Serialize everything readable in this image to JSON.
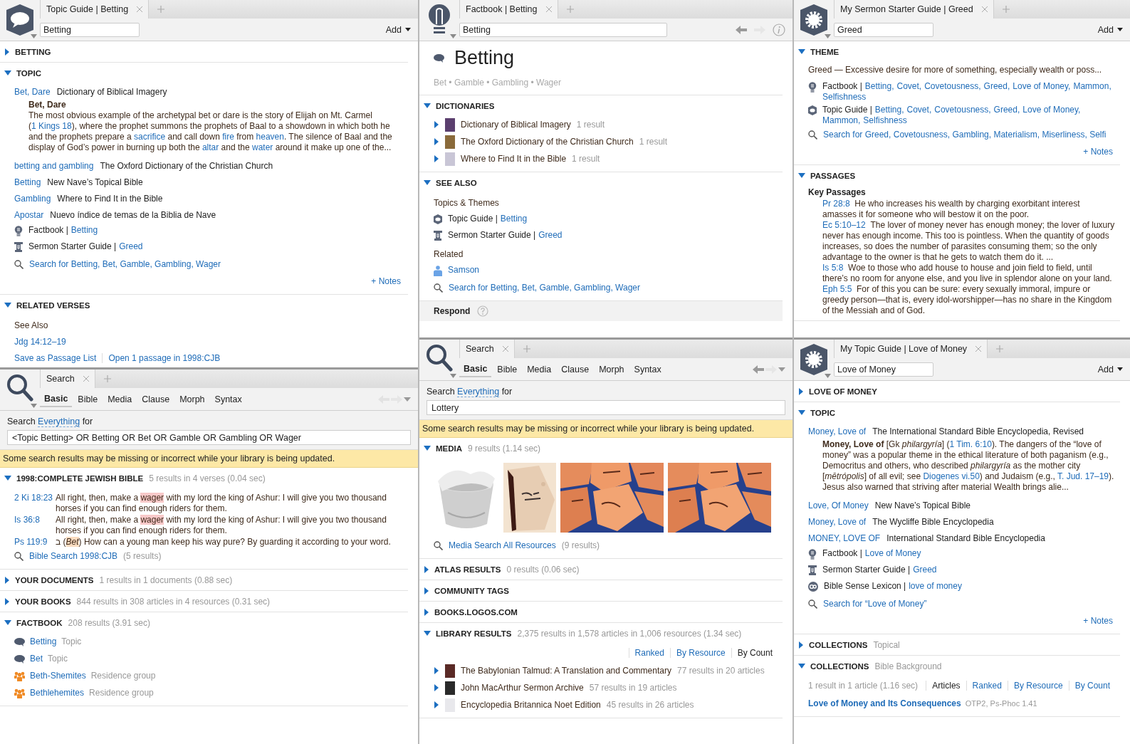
{
  "columns": [
    {
      "panels": [
        {
          "kind": "topic-guide",
          "tab": "Topic Guide | Betting",
          "field": "Betting",
          "add": "Add",
          "sections": [
            {
              "heading": "BETTING",
              "expanded": false
            },
            {
              "heading": "TOPIC",
              "expanded": true,
              "blocks": [
                {
                  "kind": "entry",
                  "link": "Bet, Dare",
                  "source": "Dictionary of Biblical Imagery"
                },
                {
                  "kind": "excerpt",
                  "parts": [
                    {
                      "kind": "title",
                      "text": "Bet, Dare"
                    },
                    {
                      "kind": "text",
                      "text": "The most obvious example of the archetypal bet or dare is the story of Elijah on Mt. Carmel ("
                    },
                    {
                      "kind": "link",
                      "text": "1 Kings 18"
                    },
                    {
                      "kind": "text",
                      "text": "), where the prophet summons the prophets of Baal to a showdown in which both he and the prophets prepare a "
                    },
                    {
                      "kind": "link",
                      "text": "sacrifice"
                    },
                    {
                      "kind": "text",
                      "text": " and call down "
                    },
                    {
                      "kind": "link",
                      "text": "fire"
                    },
                    {
                      "kind": "text",
                      "text": " from "
                    },
                    {
                      "kind": "link",
                      "text": "heaven"
                    },
                    {
                      "kind": "text",
                      "text": ". The silence of Baal and the display of God’s power in burning up both the "
                    },
                    {
                      "kind": "link",
                      "text": "altar"
                    },
                    {
                      "kind": "text",
                      "text": " and the "
                    },
                    {
                      "kind": "link",
                      "text": "water"
                    },
                    {
                      "kind": "text",
                      "text": " around it make up one of the..."
                    }
                  ]
                },
                {
                  "kind": "entry",
                  "link": "betting and gambling",
                  "source": "The Oxford Dictionary of the Christian Church"
                },
                {
                  "kind": "entry",
                  "link": "Betting",
                  "source": "New Nave’s Topical Bible"
                },
                {
                  "kind": "entry",
                  "link": "Gambling",
                  "source": "Where to Find It in the Bible"
                },
                {
                  "kind": "entry",
                  "link": "Apostar",
                  "source": "Nuevo índice de temas de la Biblia de Nave"
                },
                {
                  "kind": "factbook-ref",
                  "name": "Factbook",
                  "sep": "|",
                  "links": [
                    "Betting"
                  ]
                },
                {
                  "kind": "sermon-ref",
                  "name": "Sermon Starter Guide",
                  "sep": "|",
                  "links": [
                    "Greed"
                  ]
                },
                {
                  "kind": "search",
                  "text": "Search for Betting, Bet, Gamble, Gambling, Wager"
                },
                {
                  "kind": "notes",
                  "text": "+ Notes"
                }
              ]
            },
            {
              "heading": "RELATED VERSES",
              "expanded": true,
              "blocks": [
                {
                  "kind": "label",
                  "text": "See Also"
                },
                {
                  "kind": "link",
                  "text": "Jdg 14:12–19"
                },
                {
                  "kind": "actions",
                  "links": [
                    "Save as Passage List",
                    "Open 1 passage in 1998:CJB"
                  ]
                }
              ]
            }
          ]
        },
        {
          "kind": "search",
          "tab": "Search",
          "can_go_back": false,
          "modes": [
            {
              "label": "Basic",
              "selected": true
            },
            {
              "label": "Bible",
              "selected": false
            },
            {
              "label": "Media",
              "selected": false
            },
            {
              "label": "Clause",
              "selected": false
            },
            {
              "label": "Morph",
              "selected": false
            },
            {
              "label": "Syntax",
              "selected": false
            }
          ],
          "prompt": {
            "before": "Search",
            "scope": "Everything",
            "after": "for"
          },
          "query": "<Topic Betting> OR Betting OR Bet OR Gamble OR Gambling OR Wager",
          "banner": "Some search results may be missing or incorrect while your library is being updated.",
          "sections": [
            {
              "heading": "1998:COMPLETE JEWISH BIBLE",
              "expanded": true,
              "meta": "5 results in 4 verses (0.04 sec)",
              "blocks": [
                {
                  "kind": "hit",
                  "ref": "2 Ki 18:23",
                  "parts": [
                    {
                      "kind": "text",
                      "text": "All right, then, make a "
                    },
                    {
                      "kind": "hit",
                      "text": "wager"
                    },
                    {
                      "kind": "text",
                      "text": " with my lord the king of Ashur: I will give you two thousand horses if you can find enough riders for them."
                    }
                  ]
                },
                {
                  "kind": "hit",
                  "ref": "Is 36:8",
                  "parts": [
                    {
                      "kind": "text",
                      "text": "All right, then, make a "
                    },
                    {
                      "kind": "hit",
                      "text": "wager"
                    },
                    {
                      "kind": "text",
                      "text": " with my lord the king of Ashur: I will give you two thousand horses if you can find enough riders for them."
                    }
                  ]
                },
                {
                  "kind": "hit",
                  "ref": "Ps 119:9",
                  "parts": [
                    {
                      "kind": "text",
                      "text": "ב ("
                    },
                    {
                      "kind": "hit-italic",
                      "text": "Bet"
                    },
                    {
                      "kind": "text",
                      "text": ") How can a young man keep his way pure? By guarding it according to your word."
                    }
                  ]
                },
                {
                  "kind": "search",
                  "text": "Bible Search 1998:CJB",
                  "count": "(5 results)"
                }
              ]
            },
            {
              "heading": "YOUR DOCUMENTS",
              "expanded": false,
              "meta": "1 results in 1 documents (0.88 sec)"
            },
            {
              "heading": "YOUR BOOKS",
              "expanded": false,
              "meta": "844 results in 308 articles in 4 resources (0.31 sec)"
            },
            {
              "heading": "FACTBOOK",
              "expanded": true,
              "meta": "208 results (3.91 sec)",
              "blocks": [
                {
                  "kind": "topic-fact",
                  "name": "Betting",
                  "type": "Topic"
                },
                {
                  "kind": "topic-fact",
                  "name": "Bet",
                  "type": "Topic"
                },
                {
                  "kind": "group-fact",
                  "name": "Beth-Shemites",
                  "type": "Residence group"
                },
                {
                  "kind": "group-fact",
                  "name": "Bethlehemites",
                  "type": "Residence group"
                }
              ]
            }
          ]
        }
      ]
    },
    {
      "panels": [
        {
          "kind": "factbook",
          "tab": "Factbook | Betting",
          "field": "Betting",
          "can_go_back": true,
          "footer": "Respond",
          "sections": [
            {
              "blocks": [
                {
                  "kind": "title",
                  "text": "Betting",
                  "aliases": "Bet • Gamble • Gambling • Wager"
                }
              ]
            },
            {
              "heading": "DICTIONARIES",
              "expanded": true,
              "blocks": [
                {
                  "kind": "book",
                  "expanded": false,
                  "color": "#5b3f6e",
                  "title": "Dictionary of Biblical Imagery",
                  "meta": "1 result"
                },
                {
                  "kind": "book",
                  "expanded": false,
                  "color": "#8a6a3a",
                  "title": "The Oxford Dictionary of the Christian Church",
                  "meta": "1 result"
                },
                {
                  "kind": "book",
                  "expanded": false,
                  "color": "#c9c6d6",
                  "title": "Where to Find It in the Bible",
                  "meta": "1 result"
                }
              ]
            },
            {
              "heading": "SEE ALSO",
              "expanded": true,
              "blocks": [
                {
                  "kind": "label",
                  "text": "Topics & Themes"
                },
                {
                  "kind": "topic-ref",
                  "name": "Topic Guide",
                  "sep": "|",
                  "links": [
                    "Betting"
                  ]
                },
                {
                  "kind": "sermon-ref",
                  "name": "Sermon Starter Guide",
                  "sep": "|",
                  "links": [
                    "Greed"
                  ]
                },
                {
                  "kind": "label",
                  "text": "Related"
                },
                {
                  "kind": "person-ref",
                  "links": [
                    "Samson"
                  ]
                },
                {
                  "kind": "search",
                  "text": "Search for Betting, Bet, Gamble, Gambling, Wager"
                }
              ]
            }
          ]
        },
        {
          "kind": "search",
          "tab": "Search",
          "can_go_back": true,
          "modes": [
            {
              "label": "Basic",
              "selected": true
            },
            {
              "label": "Bible",
              "selected": false
            },
            {
              "label": "Media",
              "selected": false
            },
            {
              "label": "Clause",
              "selected": false
            },
            {
              "label": "Morph",
              "selected": false
            },
            {
              "label": "Syntax",
              "selected": false
            }
          ],
          "prompt": {
            "before": "Search",
            "scope": "Everything",
            "after": "for"
          },
          "query": "Lottery",
          "banner": "Some search results may be missing or incorrect while your library is being updated.",
          "sections": [
            {
              "heading": "MEDIA",
              "expanded": true,
              "meta": "9 results (1.14 sec)",
              "blocks": [
                {
                  "kind": "media"
                },
                {
                  "kind": "search",
                  "text": "Media Search All Resources",
                  "count": "(9 results)"
                }
              ]
            },
            {
              "heading": "ATLAS RESULTS",
              "expanded": false,
              "meta": "0 results (0.06 sec)"
            },
            {
              "heading": "COMMUNITY TAGS",
              "expanded": false
            },
            {
              "heading": "BOOKS.LOGOS.COM",
              "expanded": false
            },
            {
              "heading": "LIBRARY RESULTS",
              "expanded": true,
              "meta": "2,375 results in 1,578 articles in 1,006 resources (1.34 sec)",
              "blocks": [
                {
                  "kind": "sort",
                  "options": [
                    {
                      "label": "Ranked",
                      "selected": false
                    },
                    {
                      "label": "By Resource",
                      "selected": false
                    },
                    {
                      "label": "By Count",
                      "selected": true
                    }
                  ]
                },
                {
                  "kind": "book",
                  "expanded": false,
                  "color": "#5a2a26",
                  "title": "The Babylonian Talmud: A Translation and Commentary",
                  "meta": "77 results in 20 articles"
                },
                {
                  "kind": "book",
                  "expanded": false,
                  "color": "#2a2a2a",
                  "title": "John MacArthur Sermon Archive",
                  "meta": "57 results in 19 articles"
                },
                {
                  "kind": "book",
                  "expanded": false,
                  "color": "#e8e8ec",
                  "title": "Encyclopedia Britannica Noet Edition",
                  "meta": "45 results in 26 articles"
                }
              ]
            }
          ]
        }
      ]
    },
    {
      "panels": [
        {
          "kind": "custom-guide",
          "tab": "My Sermon Starter Guide | Greed",
          "field": "Greed",
          "add": "Add",
          "sections": [
            {
              "heading": "THEME",
              "expanded": true,
              "blocks": [
                {
                  "kind": "text",
                  "text": "Greed — Excessive desire for more of something, especially wealth or poss..."
                },
                {
                  "kind": "factbook-ref",
                  "name": "Factbook",
                  "sep": "|",
                  "links": [
                    "Betting,",
                    "Covet,",
                    "Covetousness,",
                    "Greed,",
                    "Love of Money,",
                    "Mammon,",
                    "Selfishness"
                  ]
                },
                {
                  "kind": "topic-ref",
                  "name": "Topic Guide",
                  "sep": "|",
                  "links": [
                    "Betting,",
                    "Covet,",
                    "Covetousness,",
                    "Greed,",
                    "Love of Money,",
                    "Mammon,",
                    "Selfishness"
                  ]
                },
                {
                  "kind": "search",
                  "text": "Search for Greed, Covetousness, Gambling, Materialism, Miserliness, Selfi"
                },
                {
                  "kind": "notes",
                  "text": "+ Notes"
                }
              ]
            },
            {
              "heading": "PASSAGES",
              "expanded": true,
              "blocks": [
                {
                  "kind": "subheading",
                  "text": "Key Passages"
                },
                {
                  "kind": "passage",
                  "ref": "Pr 28:8",
                  "text": "He who increases his wealth by charging exorbitant interest amasses it for someone who will bestow it on the poor."
                },
                {
                  "kind": "passage",
                  "ref": "Ec 5:10–12",
                  "text": "The lover of money never has enough money; the lover of luxury never has enough income. This too is pointless. When the quantity of goods increases, so does the number of parasites consuming them; so the only advantage to the owner is that he gets to watch them do it. ..."
                },
                {
                  "kind": "passage",
                  "ref": "Is 5:8",
                  "text": "Woe to those who add house to house and join field to field, until there’s no room for anyone else, and you live in splendor alone on your land."
                },
                {
                  "kind": "passage",
                  "ref": "Eph 5:5",
                  "text": "For of this you can be sure: every sexually immoral, impure or greedy person—that is, every idol-worshipper—has no share in the Kingdom of the Messiah and of God."
                }
              ]
            }
          ]
        },
        {
          "kind": "custom-guide",
          "tab": "My Topic Guide | Love of Money",
          "field": "Love of Money",
          "add": "Add",
          "sections": [
            {
              "heading": "LOVE OF MONEY",
              "expanded": false
            },
            {
              "heading": "TOPIC",
              "expanded": true,
              "blocks": [
                {
                  "kind": "entry",
                  "link": "Money, Love of",
                  "source": "The International Standard Bible Encyclopedia, Revised"
                },
                {
                  "kind": "excerpt",
                  "parts": [
                    {
                      "kind": "bold",
                      "text": "Money, Love of"
                    },
                    {
                      "kind": "text",
                      "text": " [Gk "
                    },
                    {
                      "kind": "italic",
                      "text": "philargyría"
                    },
                    {
                      "kind": "text",
                      "text": "] ("
                    },
                    {
                      "kind": "link",
                      "text": "1 Tim. 6:10"
                    },
                    {
                      "kind": "text",
                      "text": "). The dangers of the “love of money” was a popular theme in the ethical literature of both paganism (e.g., Democritus and others, who described "
                    },
                    {
                      "kind": "italic",
                      "text": "philargyría"
                    },
                    {
                      "kind": "text",
                      "text": " as the mother city ["
                    },
                    {
                      "kind": "italic",
                      "text": "mētrópolis"
                    },
                    {
                      "kind": "text",
                      "text": "] of all evil; see "
                    },
                    {
                      "kind": "link",
                      "text": "Diogenes vi.50"
                    },
                    {
                      "kind": "text",
                      "text": ") and Judaism (e.g., "
                    },
                    {
                      "kind": "link",
                      "text": "T. Jud. 17–19"
                    },
                    {
                      "kind": "text",
                      "text": "). Jesus also warned that striving after material Wealth brings alie..."
                    }
                  ]
                },
                {
                  "kind": "entry",
                  "link": "Love, Of Money",
                  "source": "New Nave’s Topical Bible"
                },
                {
                  "kind": "entry",
                  "link": "Money, Love of",
                  "source": "The Wycliffe Bible Encyclopedia"
                },
                {
                  "kind": "entry",
                  "link": "MONEY, LOVE OF",
                  "source": "International Standard Bible Encyclopedia"
                },
                {
                  "kind": "factbook-ref",
                  "name": "Factbook",
                  "sep": "|",
                  "links": [
                    "Love of Money"
                  ]
                },
                {
                  "kind": "sermon-ref",
                  "name": "Sermon Starter Guide",
                  "sep": "|",
                  "links": [
                    "Greed"
                  ]
                },
                {
                  "kind": "lexicon-ref",
                  "name": "Bible Sense Lexicon",
                  "sep": "|",
                  "links": [
                    "love of money"
                  ]
                },
                {
                  "kind": "search",
                  "text": "Search for “Love of Money”"
                },
                {
                  "kind": "notes",
                  "text": "+ Notes"
                }
              ]
            },
            {
              "heading": "COLLECTIONS",
              "expanded": false,
              "meta": "Topical"
            },
            {
              "heading": "COLLECTIONS",
              "expanded": true,
              "meta": "Bible Background",
              "blocks": [
                {
                  "kind": "sort",
                  "lead": "1 result in 1 article (1.16 sec)",
                  "options": [
                    {
                      "label": "Articles",
                      "selected": true
                    },
                    {
                      "label": "Ranked",
                      "selected": false
                    },
                    {
                      "label": "By Resource",
                      "selected": false
                    },
                    {
                      "label": "By Count",
                      "selected": false
                    }
                  ]
                },
                {
                  "kind": "result",
                  "title": "Love of Money and Its Consequences",
                  "meta": "OTP2, Ps-Phoc 1.41"
                }
              ]
            }
          ]
        }
      ]
    }
  ]
}
